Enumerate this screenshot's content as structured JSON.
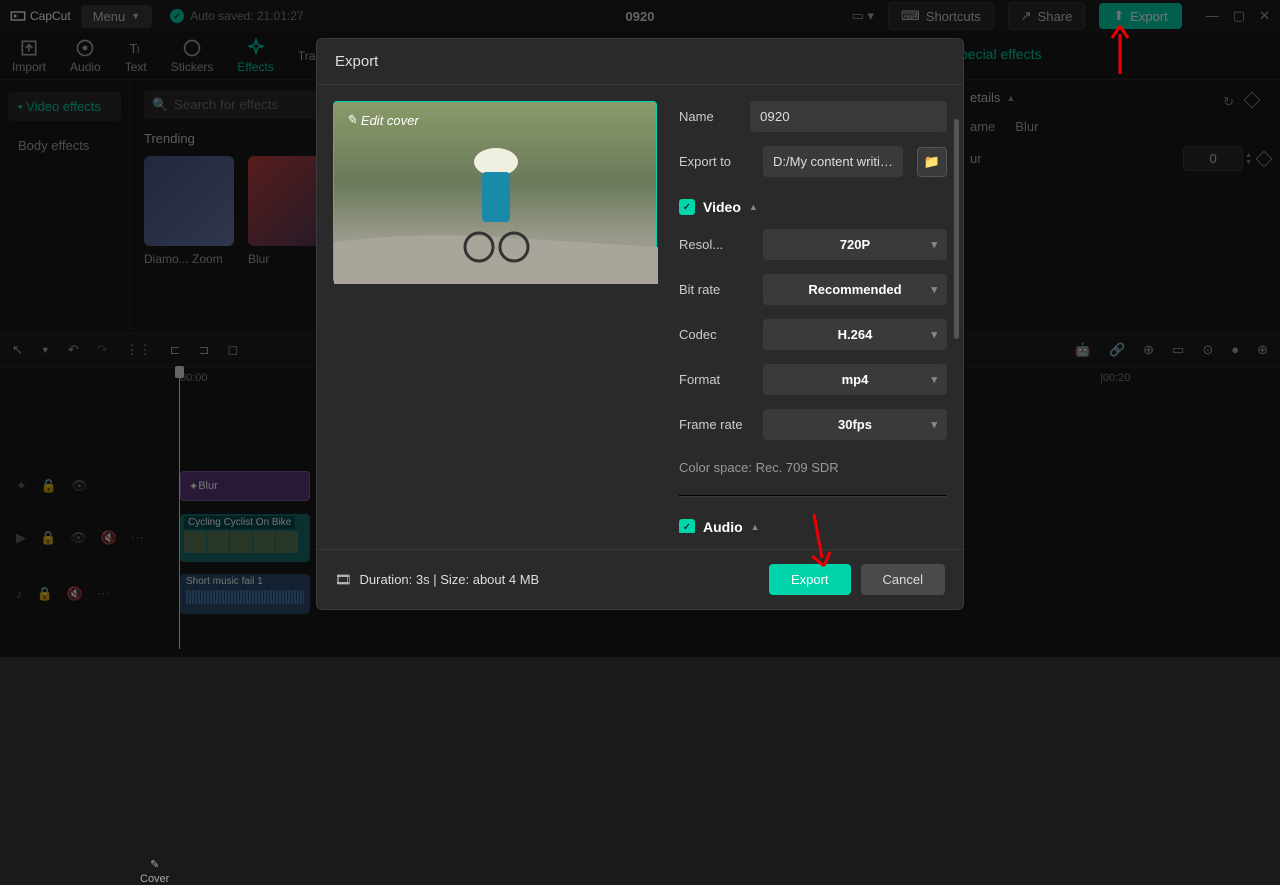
{
  "app": {
    "name": "CapCut",
    "menu": "Menu",
    "autosave": "Auto saved: 21:01:27",
    "project": "0920"
  },
  "topbar": {
    "shortcuts": "Shortcuts",
    "share": "Share",
    "export": "Export"
  },
  "tabs": {
    "import": "Import",
    "audio": "Audio",
    "text": "Text",
    "stickers": "Stickers",
    "effects": "Effects",
    "transitions": "Tra..."
  },
  "sidebar": {
    "video_effects": "Video effects",
    "body_effects": "Body effects"
  },
  "effects": {
    "search_ph": "Search for effects",
    "trending": "Trending",
    "t1": "Diamo... Zoom",
    "t2": "Blur"
  },
  "special": "pecial effects",
  "props": {
    "details": "etails",
    "name": "ame",
    "blur": "Blur",
    "ur": "ur",
    "value": "0"
  },
  "ruler": {
    "t0": "00:00",
    "t20": "|00:20"
  },
  "clips": {
    "effect": "Blur",
    "video": "Cycling Cyclist On Bike",
    "audio": "Short music fail 1",
    "cover": "Cover"
  },
  "modal": {
    "title": "Export",
    "edit_cover": "Edit cover",
    "name_lbl": "Name",
    "name_val": "0920",
    "export_to_lbl": "Export to",
    "export_to_val": "D:/My content writin...",
    "video": "Video",
    "audio": "Audio",
    "resolution_lbl": "Resol...",
    "resolution_val": "720P",
    "bitrate_lbl": "Bit rate",
    "bitrate_val": "Recommended",
    "codec_lbl": "Codec",
    "codec_val": "H.264",
    "format_lbl": "Format",
    "format_val": "mp4",
    "framerate_lbl": "Frame rate",
    "framerate_val": "30fps",
    "colorspace": "Color space: Rec. 709 SDR",
    "duration": "Duration: 3s | Size: about 4 MB",
    "export_btn": "Export",
    "cancel_btn": "Cancel"
  }
}
